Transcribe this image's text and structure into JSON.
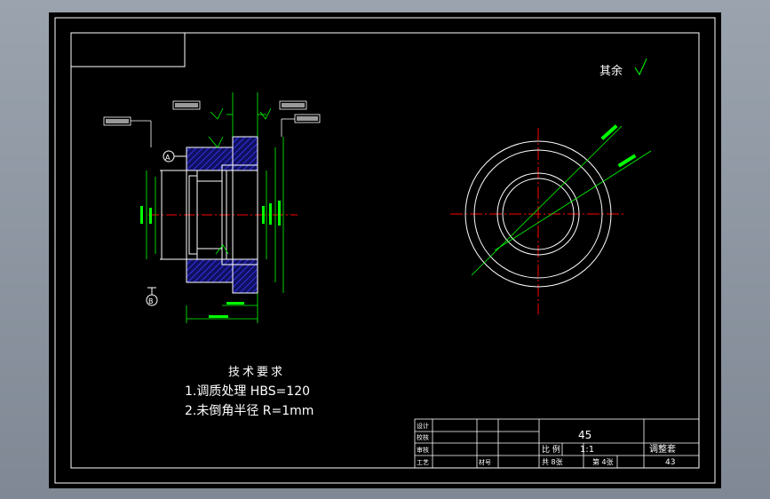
{
  "title_note": "其余",
  "datum_a": "A",
  "datum_b": "B",
  "tech_requirements": {
    "heading": "技术要求",
    "line1": "1.调质处理 HBS=120",
    "line2": "2.未倒角半径 R=1mm"
  },
  "title_block": {
    "labels": {
      "design": "设计",
      "check": "校核",
      "review": "审核",
      "process": "工艺",
      "sheet_label": "材号",
      "scale_label": "比 例",
      "total_sheets": "共 8张",
      "sheet_no": "第 4张"
    },
    "material": "45",
    "scale": "1:1",
    "part_name": "调整套",
    "drawing_no": "43"
  },
  "colors": {
    "background": "#000000",
    "frame": "#ffffff",
    "dimension": "#00ff00",
    "centerline": "#ff0000",
    "hatch": "#2a2aff",
    "page": "#8e97a3"
  }
}
